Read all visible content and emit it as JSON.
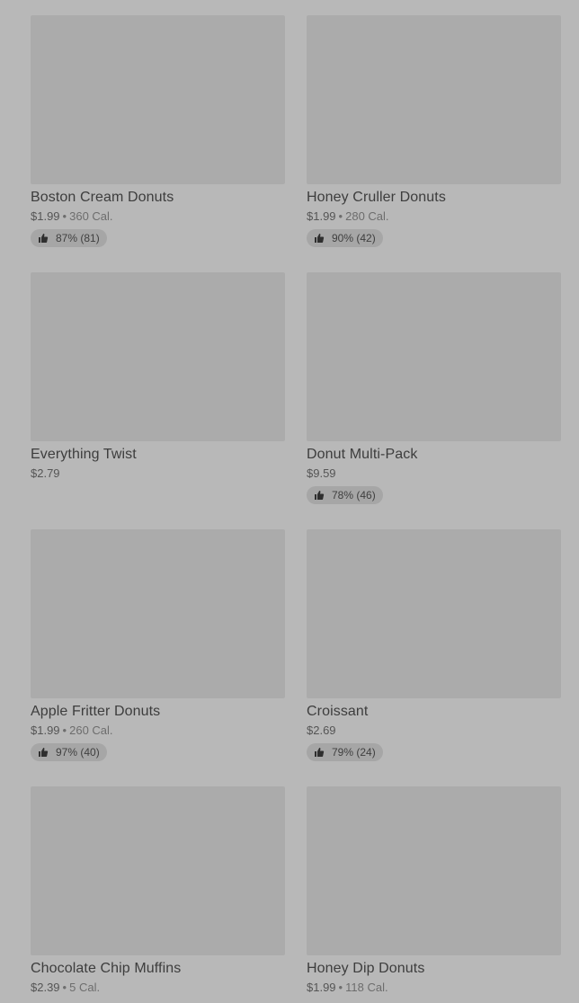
{
  "products": [
    {
      "name": "Boston Cream Donuts",
      "price": "$1.99",
      "separator": "•",
      "calories": "360 Cal.",
      "rating": "87% (81)",
      "icon": "thumbs-up-icon"
    },
    {
      "name": "Honey Cruller Donuts",
      "price": "$1.99",
      "separator": "•",
      "calories": "280 Cal.",
      "rating": "90% (42)",
      "icon": "thumbs-up-icon"
    },
    {
      "name": "Everything Twist",
      "price": "$2.79"
    },
    {
      "name": "Donut Multi-Pack",
      "price": "$9.59",
      "rating": "78% (46)",
      "icon": "thumbs-up-icon"
    },
    {
      "name": "Apple Fritter Donuts",
      "price": "$1.99",
      "separator": "•",
      "calories": "260 Cal.",
      "rating": "97% (40)",
      "icon": "thumbs-up-icon"
    },
    {
      "name": "Croissant",
      "price": "$2.69",
      "rating": "79% (24)",
      "icon": "thumbs-up-icon"
    },
    {
      "name": "Chocolate Chip Muffins",
      "price": "$2.39",
      "separator": "•",
      "calories": "5 Cal."
    },
    {
      "name": "Honey Dip Donuts",
      "price": "$1.99",
      "separator": "•",
      "calories": "118 Cal."
    }
  ]
}
